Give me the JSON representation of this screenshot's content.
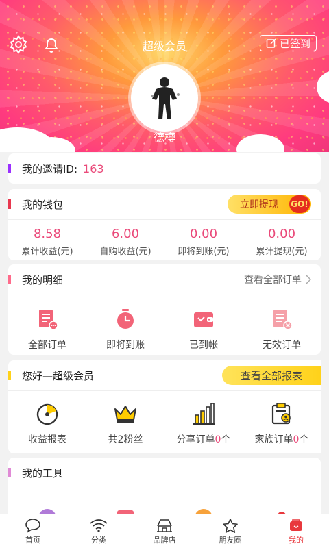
{
  "header": {
    "title": "超级会员",
    "checkin_label": "已签到",
    "username": "德樽",
    "settings_icon": "gear-icon",
    "notify_icon": "bell-icon"
  },
  "invite": {
    "label": "我的邀请ID:",
    "id": "163"
  },
  "wallet": {
    "title": "我的钱包",
    "withdraw_button": "立即提现",
    "go_badge": "GO!",
    "items": [
      {
        "value": "8.58",
        "label": "累计收益(元)"
      },
      {
        "value": "6.00",
        "label": "自购收益(元)"
      },
      {
        "value": "0.00",
        "label": "即将到账(元)"
      },
      {
        "value": "0.00",
        "label": "累计提现(元)"
      }
    ]
  },
  "details": {
    "title": "我的明细",
    "view_all": "查看全部订单",
    "items": [
      {
        "label": "全部订单",
        "icon": "all-orders-icon"
      },
      {
        "label": "即将到账",
        "icon": "timer-icon"
      },
      {
        "label": "已到帐",
        "icon": "wallet-icon"
      },
      {
        "label": "无效订单",
        "icon": "invalid-order-icon"
      }
    ]
  },
  "member": {
    "title": "您好—超级会员",
    "report_button": "查看全部报表",
    "items": [
      {
        "label": "收益报表",
        "icon": "report-icon"
      },
      {
        "label": "共2粉丝",
        "icon": "crown-icon"
      },
      {
        "label_prefix": "分享订单",
        "count": "0",
        "label_suffix": "个",
        "icon": "bar-chart-icon"
      },
      {
        "label_prefix": "家族订单",
        "count": "0",
        "label_suffix": "个",
        "icon": "clipboard-icon"
      }
    ]
  },
  "tools": {
    "title": "我的工具"
  },
  "tabbar": {
    "items": [
      {
        "label": "首页",
        "icon": "chat-bubble-icon"
      },
      {
        "label": "分类",
        "icon": "wifi-icon"
      },
      {
        "label": "品牌店",
        "icon": "store-icon"
      },
      {
        "label": "朋友圈",
        "icon": "star-icon"
      },
      {
        "label": "我的",
        "icon": "me-icon"
      }
    ],
    "active_color": "#e8383d"
  },
  "colors": {
    "accent": "#ea4a7a",
    "invite_bar": "#9b30ff",
    "wallet_bar": "#e8384f",
    "detail_bar": "#ff6b8b",
    "member_bar": "#ffd21a",
    "tools_bar": "#e08ad6"
  }
}
